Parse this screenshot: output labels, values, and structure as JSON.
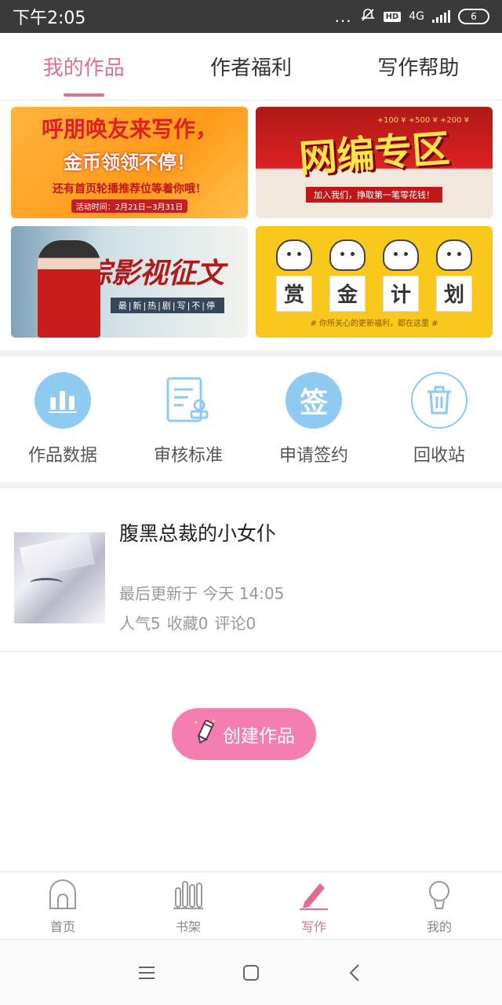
{
  "status_bar": {
    "time": "下午2:05",
    "dots": "...",
    "hd": "HD",
    "network": "4G",
    "battery": "6"
  },
  "tabs": [
    {
      "label": "我的作品",
      "active": true
    },
    {
      "label": "作者福利",
      "active": false
    },
    {
      "label": "写作帮助",
      "active": false
    }
  ],
  "banners": {
    "b1": {
      "line1": "呼朋唤友来写作，",
      "line2": "金币领领不停！",
      "line3": "还有首页轮播推荐位等着你哦！",
      "line4": "活动时间：2月21日~3月31日"
    },
    "b2": {
      "title": "网编专区",
      "sub": "加入我们，挣取第一笔零花钱！",
      "mini": "+100 ¥  +500 ¥  +200 ¥"
    },
    "b3": {
      "title": "综影视征文",
      "sub": "最|新|热|剧|写|不|停"
    },
    "b4": {
      "chars": [
        "赏",
        "金",
        "计",
        "划"
      ],
      "note": "# 你所关心的更新福利，都在这里 #"
    }
  },
  "actions": [
    {
      "label": "作品数据",
      "icon": "bar-chart-icon"
    },
    {
      "label": "审核标准",
      "icon": "document-stamp-icon"
    },
    {
      "label": "申请签约",
      "icon": "sign-icon",
      "glyph": "签"
    },
    {
      "label": "回收站",
      "icon": "trash-icon"
    }
  ],
  "work": {
    "title": "腹黑总裁的小女仆",
    "updated": "最后更新于 今天 14:05",
    "popularity": "人气5",
    "favorites": "收藏0",
    "comments": "评论0"
  },
  "create_button": {
    "label": "创建作品"
  },
  "bottom_nav": [
    {
      "label": "首页",
      "active": false,
      "icon": "home-icon"
    },
    {
      "label": "书架",
      "active": false,
      "icon": "bookshelf-icon"
    },
    {
      "label": "写作",
      "active": true,
      "icon": "pen-icon"
    },
    {
      "label": "我的",
      "active": false,
      "icon": "profile-icon"
    }
  ],
  "colors": {
    "accent": "#e06f8f",
    "button": "#f57eb0",
    "icon_blue": "#8fcaf0"
  }
}
